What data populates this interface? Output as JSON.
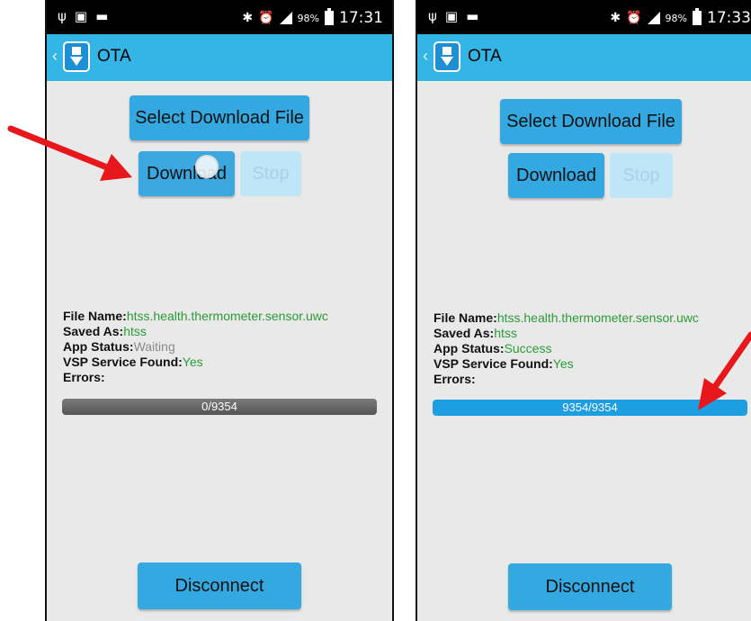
{
  "screens": [
    {
      "status": {
        "battery": "98%",
        "time": "17:31"
      },
      "title": "OTA",
      "buttons": {
        "select": "Select Download File",
        "download": "Download",
        "stop": "Stop",
        "disconnect": "Disconnect"
      },
      "info": {
        "file_name_label": "File Name:",
        "file_name": "htss.health.thermometer.sensor.uwc",
        "saved_as_label": "Saved As:",
        "saved_as": "htss",
        "app_status_label": "App Status:",
        "app_status": "Waiting",
        "vsp_label": "VSP Service Found:",
        "vsp": "Yes",
        "errors_label": "Errors:"
      },
      "progress": {
        "text": "0/9354",
        "fraction": 0
      }
    },
    {
      "status": {
        "battery": "98%",
        "time": "17:33"
      },
      "title": "OTA",
      "buttons": {
        "select": "Select Download File",
        "download": "Download",
        "stop": "Stop",
        "disconnect": "Disconnect"
      },
      "info": {
        "file_name_label": "File Name:",
        "file_name": "htss.health.thermometer.sensor.uwc",
        "saved_as_label": "Saved As:",
        "saved_as": "htss",
        "app_status_label": "App Status:",
        "app_status": "Success",
        "vsp_label": "VSP Service Found:",
        "vsp": "Yes",
        "errors_label": "Errors:"
      },
      "progress": {
        "text": "9354/9354",
        "fraction": 1
      }
    }
  ],
  "colors": {
    "accent": "#33b5e5",
    "button": "#34a9e1",
    "success_text": "#2b9b38",
    "annotation_arrow": "#e8171c"
  }
}
